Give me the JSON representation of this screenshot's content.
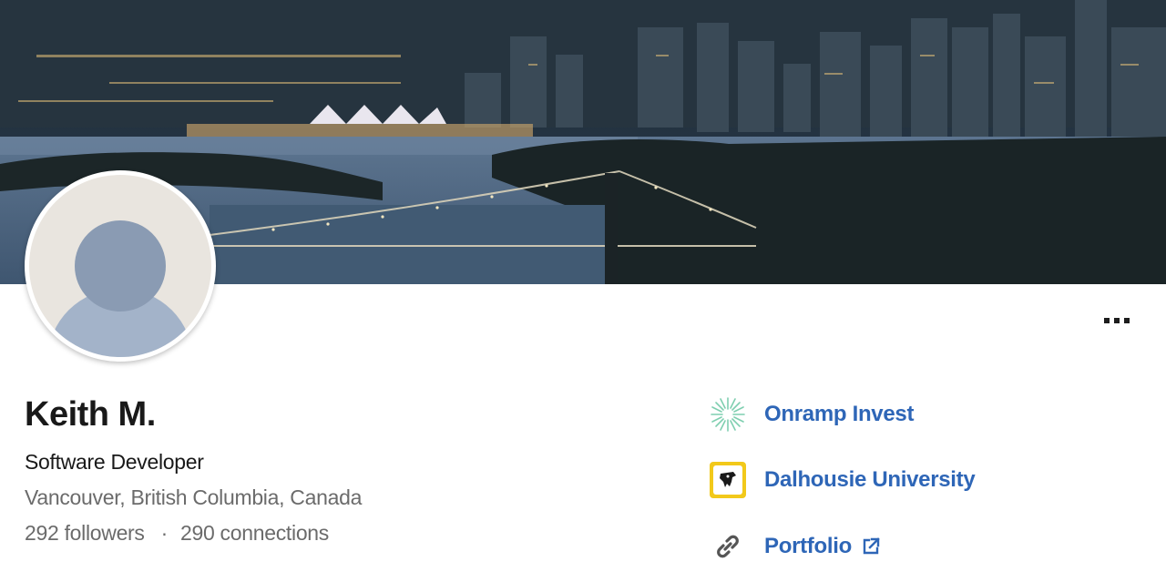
{
  "profile": {
    "name": "Keith M.",
    "headline": "Software Developer",
    "location": "Vancouver, British Columbia, Canada",
    "followers": "292 followers",
    "separator": "·",
    "connections": "290 connections"
  },
  "links": [
    {
      "label": "Onramp Invest",
      "icon": "onramp-logo-icon"
    },
    {
      "label": "Dalhousie University",
      "icon": "dalhousie-logo-icon"
    },
    {
      "label": "Portfolio",
      "icon": "link-icon",
      "external": true
    }
  ],
  "more_actions": {
    "icon": "more-dots-icon"
  },
  "colors": {
    "link": "#2e66b7",
    "text": "#191919",
    "muted": "#6b6b6b",
    "dalhousie_bg": "#f2c91a"
  }
}
